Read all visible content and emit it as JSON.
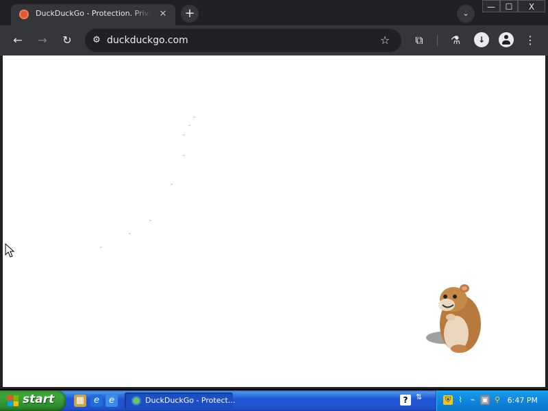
{
  "browser": {
    "tab": {
      "title": "DuckDuckGo - Protection. Privacy. Peace of mind.",
      "close_glyph": "✕"
    },
    "new_tab_glyph": "+",
    "tab_search_glyph": "⌄",
    "window_controls": {
      "minimize": "—",
      "maximize": "☐",
      "close": "X"
    },
    "toolbar": {
      "back_glyph": "←",
      "forward_glyph": "→",
      "reload_glyph": "↻",
      "url": "duckduckgo.com",
      "site_info_glyph": "⚙",
      "bookmark_glyph": "☆",
      "extensions_glyph": "⧉",
      "labs_glyph": "⚗",
      "download_glyph": "↓",
      "menu_glyph": "⋮"
    }
  },
  "taskbar": {
    "start_label": "start",
    "quick_launch": [
      {
        "icon": "desktop-icon",
        "glyph": "▦"
      },
      {
        "icon": "ie-icon",
        "glyph": "e"
      },
      {
        "icon": "ie-alt-icon",
        "glyph": "e"
      }
    ],
    "active_task_label": "DuckDuckGo - Protect...",
    "help_glyph": "?",
    "network_glyph": "⇅",
    "clock": "6:47 PM"
  },
  "colors": {
    "browser_frame": "#202124",
    "toolbar": "#35363a",
    "taskbar_blue": "#2157d7",
    "start_green": "#3aa83a",
    "tray_blue": "#1189e0"
  }
}
